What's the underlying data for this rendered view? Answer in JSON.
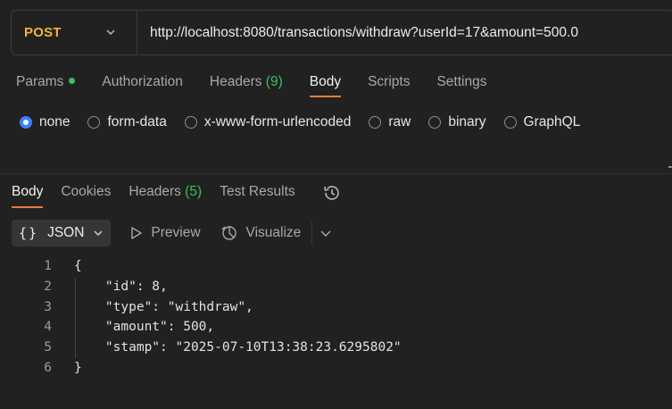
{
  "request": {
    "method": "POST",
    "url": "http://localhost:8080/transactions/withdraw?userId=17&amount=500.0"
  },
  "request_tabs": [
    {
      "label": "Params",
      "has_dot": true
    },
    {
      "label": "Authorization"
    },
    {
      "label": "Headers",
      "count": "(9)"
    },
    {
      "label": "Body",
      "active": true
    },
    {
      "label": "Scripts"
    },
    {
      "label": "Settings"
    }
  ],
  "body_options": [
    {
      "label": "none",
      "selected": true
    },
    {
      "label": "form-data"
    },
    {
      "label": "x-www-form-urlencoded"
    },
    {
      "label": "raw"
    },
    {
      "label": "binary"
    },
    {
      "label": "GraphQL"
    }
  ],
  "response_tabs": [
    {
      "label": "Body",
      "active": true
    },
    {
      "label": "Cookies"
    },
    {
      "label": "Headers",
      "count": "(5)"
    },
    {
      "label": "Test Results"
    }
  ],
  "response_toolbar": {
    "format_label": "JSON",
    "preview_label": "Preview",
    "visualize_label": "Visualize"
  },
  "code_lines": [
    {
      "num": "1",
      "text": "{"
    },
    {
      "num": "2",
      "text": "    \"id\": 8,"
    },
    {
      "num": "3",
      "text": "    \"type\": \"withdraw\","
    },
    {
      "num": "4",
      "text": "    \"amount\": 500,"
    },
    {
      "num": "5",
      "text": "    \"stamp\": \"2025-07-10T13:38:23.6295802\""
    },
    {
      "num": "6",
      "text": "}"
    }
  ],
  "colors": {
    "method": "#f1b23c",
    "accent_underline": "#f37a3e",
    "count_green": "#3fbf60",
    "radio_selected": "#3b82f6"
  }
}
